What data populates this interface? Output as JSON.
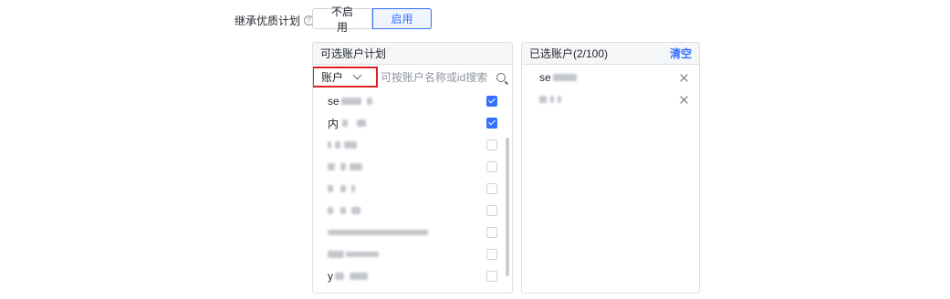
{
  "field": {
    "label": "继承优质计划",
    "help_icon": "question-circle-icon"
  },
  "toggle": {
    "options": [
      "不启用",
      "启用"
    ],
    "selected": "启用"
  },
  "available_panel": {
    "title": "可选账户计划",
    "type_select": "账户",
    "search_placeholder": "可按账户名称或id搜索",
    "items": [
      {
        "text_prefix": "se",
        "checked": true
      },
      {
        "text_prefix": "内",
        "checked": true
      },
      {
        "text_prefix": "",
        "checked": false
      },
      {
        "text_prefix": "",
        "checked": false
      },
      {
        "text_prefix": "",
        "checked": false
      },
      {
        "text_prefix": "",
        "checked": false
      },
      {
        "text_prefix": "",
        "checked": false
      },
      {
        "text_prefix": "",
        "checked": false
      },
      {
        "text_prefix": "y",
        "checked": false
      }
    ]
  },
  "selected_panel": {
    "title": "已选账户(2/100)",
    "clear_label": "清空",
    "items": [
      {
        "text_prefix": "se"
      },
      {
        "text_prefix": ""
      }
    ]
  },
  "colors": {
    "accent": "#3370ff",
    "highlight_border": "#e02020"
  }
}
